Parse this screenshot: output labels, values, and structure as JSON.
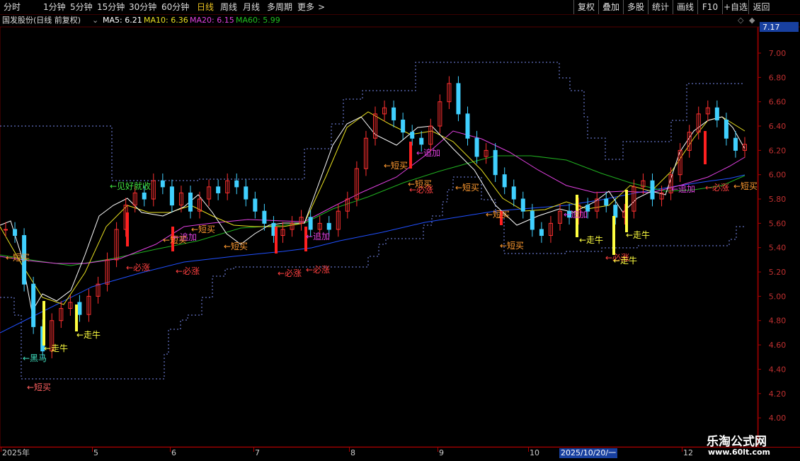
{
  "periods": [
    {
      "label": "分时",
      "active": false
    },
    {
      "label": "1分钟",
      "active": false
    },
    {
      "label": "5分钟",
      "active": false
    },
    {
      "label": "15分钟",
      "active": false
    },
    {
      "label": "30分钟",
      "active": false
    },
    {
      "label": "60分钟",
      "active": false
    },
    {
      "label": "日线",
      "active": true
    },
    {
      "label": "周线",
      "active": false
    },
    {
      "label": "月线",
      "active": false
    },
    {
      "label": "多周期",
      "active": false
    },
    {
      "label": "更多",
      "active": false
    }
  ],
  "more_arrow": ">",
  "tools": [
    "复权",
    "叠加",
    "多股",
    "统计",
    "画线",
    "F10",
    "+自选",
    "返回"
  ],
  "stock_title": "国发股份(日线 前复权)",
  "dropdown_icon": "⌄",
  "ma": [
    {
      "label": "MA5: 6.21",
      "color": "#ffffff"
    },
    {
      "label": "MA10: 6.36",
      "color": "#e8e020"
    },
    {
      "label": "MA20: 6.15",
      "color": "#e040e0"
    },
    {
      "label": "MA60: 5.99",
      "color": "#20c020"
    }
  ],
  "top_price": "7.17",
  "price_axis": [
    "7.00",
    "6.80",
    "6.60",
    "6.40",
    "6.20",
    "6.00",
    "5.80",
    "5.60",
    "5.40",
    "5.20",
    "5.00",
    "4.80",
    "4.60",
    "4.40",
    "4.20",
    "4.00"
  ],
  "date_axis": {
    "labels": [
      "2025年",
      "5",
      "6",
      "7",
      "8",
      "9",
      "10",
      "12"
    ],
    "highlight": "2025/10/20/一"
  },
  "watermark": {
    "title": "乐淘公式网",
    "url": "www.60lt.com"
  },
  "annotations": [
    {
      "text": "←短买",
      "color": "#ff9a30"
    },
    {
      "text": "←黑马",
      "color": "#40e0c0"
    },
    {
      "text": "←短买",
      "color": "#ff6060"
    },
    {
      "text": "←走牛",
      "color": "#ffff40"
    },
    {
      "text": "←走牛",
      "color": "#ffff40"
    },
    {
      "text": "←必涨",
      "color": "#ff4040"
    },
    {
      "text": "←见好就收",
      "color": "#40e040"
    },
    {
      "text": "←必涨",
      "color": "#ff4040"
    },
    {
      "text": "←短买",
      "color": "#ff9a30"
    },
    {
      "text": "←追加",
      "color": "#e040e0"
    },
    {
      "text": "←短买",
      "color": "#ff9a30"
    },
    {
      "text": "←必涨",
      "color": "#ff4040"
    },
    {
      "text": "←必涨",
      "color": "#ff4040"
    },
    {
      "text": "←追加",
      "color": "#e040e0"
    },
    {
      "text": "←短买",
      "color": "#ff9a30"
    },
    {
      "text": "←必涨",
      "color": "#ff4040"
    },
    {
      "text": "←追加",
      "color": "#e040e0"
    },
    {
      "text": "←短买",
      "color": "#ff9a30"
    },
    {
      "text": "←短买",
      "color": "#ff9a30"
    },
    {
      "text": "←短买",
      "color": "#ff9a30"
    },
    {
      "text": "←追加",
      "color": "#e040e0"
    },
    {
      "text": "←必涨",
      "color": "#ff4040"
    },
    {
      "text": "←走牛",
      "color": "#ffff40"
    },
    {
      "text": "←走牛",
      "color": "#ffff40"
    },
    {
      "text": "←走牛",
      "color": "#ffff40"
    },
    {
      "text": "←追加",
      "color": "#e040e0"
    },
    {
      "text": "←必涨",
      "color": "#ff4040"
    },
    {
      "text": "←短买",
      "color": "#ff9a30"
    },
    {
      "text": "←短买",
      "color": "#ff9a30"
    },
    {
      "text": "←短买",
      "color": "#ff9a30"
    }
  ]
}
